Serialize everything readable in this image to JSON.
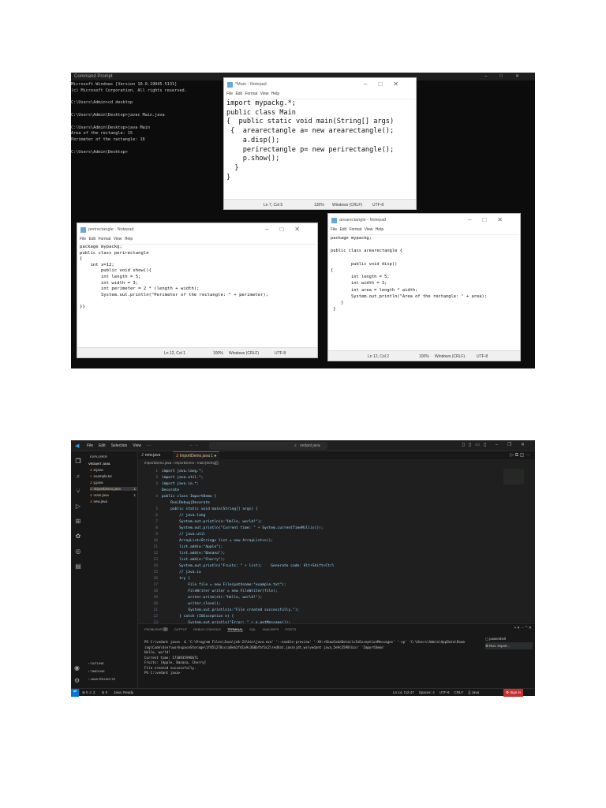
{
  "cmd": {
    "title": "Command Prompt",
    "lines": [
      "Microsoft Windows [Version 10.0.19045.5131]",
      "(c) Microsoft Corporation. All rights reserved.",
      "",
      "C:\\Users\\Admin>cd desktop",
      "",
      "C:\\Users\\Admin\\Desktop>javac Main.java",
      "",
      "C:\\Users\\Admin\\Desktop>java Main",
      "Area of the rectangle: 15",
      "Perimeter of the rectangle: 16",
      "",
      "C:\\Users\\Admin\\Desktop>"
    ]
  },
  "np_menu": "File Edit Format View Help",
  "np_main": {
    "title": "*Main - Notepad",
    "code": "import mypackg.*;\npublic class Main\n{  public static void main(String[] args)\n {  arearectangle a= new arearectangle();\n    a.disp();\n    perirectangle p= new perirectangle();\n    p.show();\n  }\n}",
    "pos": "Ln 7, Col 5",
    "zoom": "130%",
    "eol": "Windows (CRLF)",
    "enc": "UTF-8"
  },
  "np_peri": {
    "title": "perirectangle - Notepad",
    "code": "package mypackg;\npublic class perirectangle\n{\n    int x=12;\n        public void show(){\n        int length = 5;\n        int width = 3;\n        int perimeter = 2 * (length + width);\n        System.out.println(\"Perimeter of the rectangle: \" + perimeter);\n\n}}",
    "pos": "Ln 12, Col 1",
    "zoom": "100%",
    "eol": "Windows (CRLF)",
    "enc": "UTF-8"
  },
  "np_area": {
    "title": "arearectangle - Notepad",
    "code": "package mypackg;\n\npublic class arearectangle {\n\n        public void disp()\n{\n        int length = 5;\n        int width = 3;\n        int area = length * width;\n        System.out.println(\"Area of the rectangle: \" + area);\n    }\n }",
    "pos": "Ln 12, Col 2",
    "zoom": "100%",
    "eol": "Windows (CRLF)",
    "enc": "UTF-8"
  },
  "vscode": {
    "menu": [
      "File",
      "Edit",
      "Selection",
      "View",
      "···"
    ],
    "search": "vedant java",
    "explorer": "EXPLORER",
    "folder": "VEDANT JAVA",
    "files": [
      {
        "name": "d.java",
        "icon": "J"
      },
      {
        "name": "example.txt",
        "icon": "≡"
      },
      {
        "name": "g.java",
        "icon": "J"
      },
      {
        "name": "ImportDemo.java",
        "icon": "J",
        "badge": "1"
      },
      {
        "name": "main.java",
        "icon": "J",
        "badge": "1"
      },
      {
        "name": "new.java",
        "icon": "J"
      }
    ],
    "tabs": [
      "new.java",
      "ImportDemo.java 1"
    ],
    "breadcrumb": "ImportDemo.java › ImportDemo › main(String[])",
    "line_numbers": "1\n2\n3\n\n4\n\n5\n6\n7\n8\n9\n10\n11\n12\n13\n14\n15\n16\n17\n18\n19\n20\n21\n22\n23\n24",
    "code": "import java.lang.*;\nimport java.util.*;\nimport java.io.*;\nDecorate\npublic class ImportDemo {\n    Run|Debug|Decorate\n    public static void main(String[] args) {\n        // java.lang\n        System.out.println(x:\"Hello, world!\");\n        System.out.println(\"Current time: \" + System.currentTimeMillis());\n        // java.util\n        ArrayList<String> list = new ArrayList<>();\n        list.add(e:\"Apple\");\n        list.add(e:\"Banana\");\n        list.add(e:\"Cherry\");\n        System.out.println(\"Fruits: \" + list);    Generate code: Alt+Shift+Ctrl\n        // java.io\n        try {\n            File file = new File(pathname:\"example.txt\");\n            FileWriter writer = new FileWriter(file);\n            writer.write(str:\"Hello, world!\");\n            writer.close();\n            System.out.println(x:\"File created successfully.\");\n        } catch (IOException e) {\n            System.out.println(\"Error: \" + e.getMessage());\n        }}",
    "panel_tabs": [
      "PROBLEMS",
      "OUTPUT",
      "DEBUG CONSOLE",
      "TERMINAL",
      "SQL",
      "JAVA DEPS",
      "PORTS"
    ],
    "problems_count": "1",
    "terminal": "PS C:\\vedant java>  & 'C:\\Program Files\\Java\\jdk-23\\bin\\java.exe' '--enable-preview' '-XX:+ShowCodeDetailsInExceptionMessages' '-cp' 'C:\\Users\\Admin\\AppData\\Roam\ning\\Code\\User\\workspaceStorage\\1f851278ccca8eb2fd1a9c368bfbf3c2\\redhat.java\\jdt_ws\\vedant java_5e9c3598\\bin' 'ImportDemo'\nHello, world!\nCurrent time: 1730935996671\nFruits: [Apple, Banana, Cherry]\nFile created successfully.\nPS C:\\vedant java>",
    "terminals": [
      "powershell",
      "Run: Import..."
    ],
    "side_sections": [
      "OUTLINE",
      "TIMELINE",
      "JAVA PROJECTS"
    ],
    "status_left": [
      "⊗ 0 ⚠ 2",
      "⊘ 0",
      "Java: Ready"
    ],
    "status_right": [
      "Ln 14, Col 47",
      "Spaces: 4",
      "UTF-8",
      "CRLF",
      "{} Java"
    ],
    "sign_in": "Sign in",
    "accent": "#0078d4"
  }
}
